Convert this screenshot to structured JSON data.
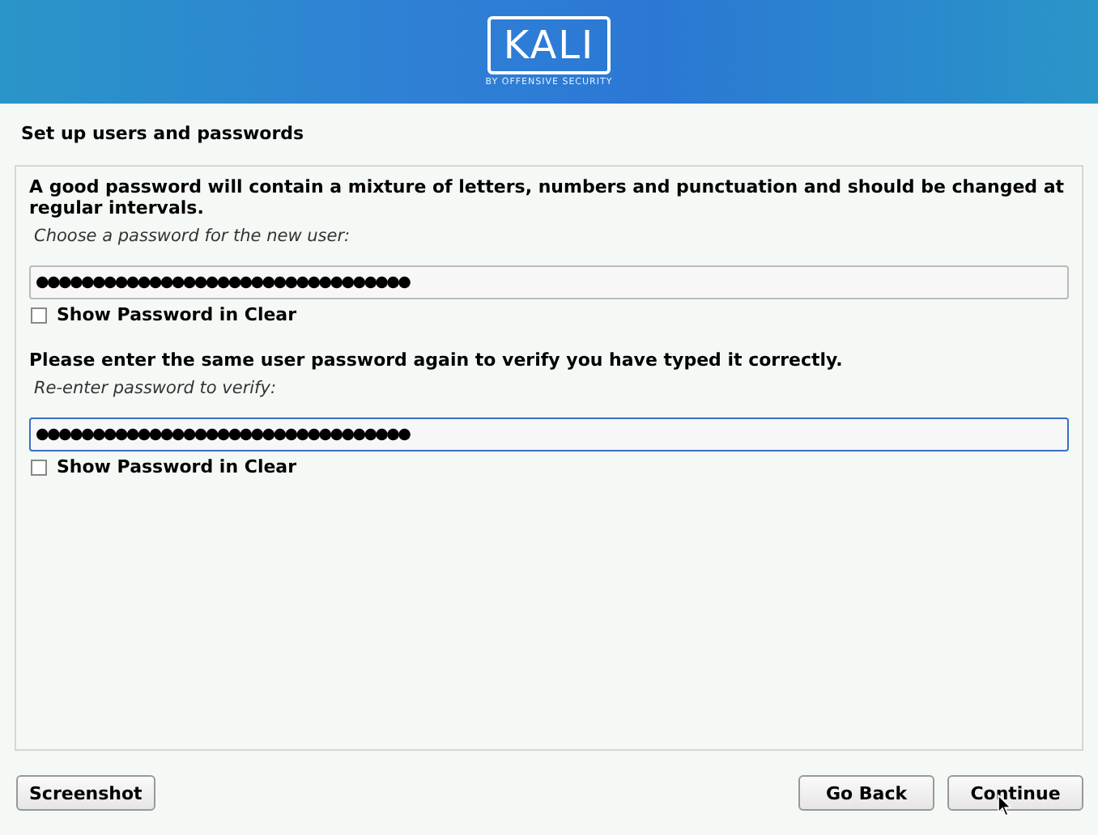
{
  "header": {
    "logo_text": "KALI",
    "logo_subtitle": "BY OFFENSIVE SECURITY"
  },
  "title": "Set up users and passwords",
  "sections": [
    {
      "intro": "A good password will contain a mixture of letters, numbers and punctuation and should be changed at regular intervals.",
      "prompt": "Choose a password for the new user:",
      "value": "●●●●●●●●●●●●●●●●●●●●●●●●●●●●●●●●●",
      "focused": false,
      "show_label": "Show Password in Clear",
      "checked": false
    },
    {
      "intro": "Please enter the same user password again to verify you have typed it correctly.",
      "prompt": "Re-enter password to verify:",
      "value": "●●●●●●●●●●●●●●●●●●●●●●●●●●●●●●●●●",
      "focused": true,
      "show_label": "Show Password in Clear",
      "checked": false
    }
  ],
  "buttons": {
    "left": "Screenshot",
    "right": [
      "Go Back",
      "Continue"
    ]
  }
}
